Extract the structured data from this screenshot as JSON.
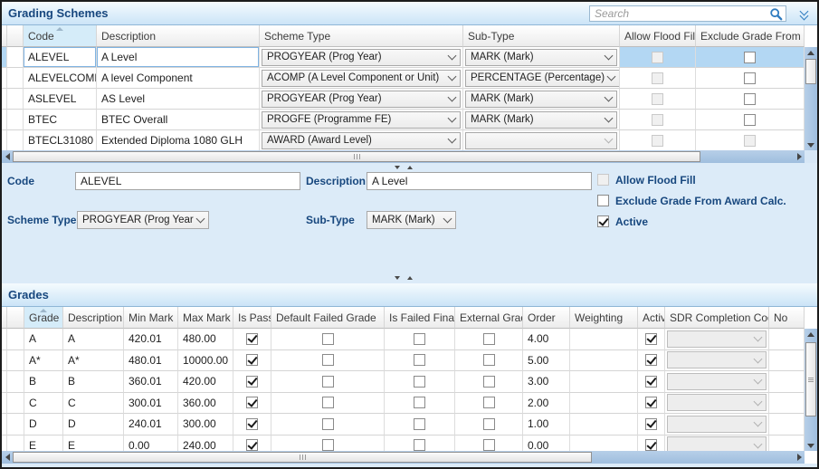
{
  "icons": {
    "search": "magnifier",
    "collapse_panel": "double-chevron-down",
    "combo": "chevron-down",
    "sort": "triangle-up",
    "check": "checkmark",
    "scroll_arrows": "triangles"
  },
  "schemes_panel": {
    "title": "Grading Schemes",
    "search_placeholder": "Search",
    "columns": [
      "Code",
      "Description",
      "Scheme Type",
      "Sub-Type",
      "Allow Flood Fill",
      "Exclude Grade From"
    ],
    "rows": [
      {
        "code": "ALEVEL",
        "description": "A Level",
        "scheme_type": "PROGYEAR (Prog Year)",
        "sub_type": "MARK (Mark)",
        "allow_flood_fill": {
          "checked": false,
          "disabled": true
        },
        "exclude_grade": {
          "checked": false,
          "disabled": false
        },
        "selected": true
      },
      {
        "code": "ALEVELCOMP",
        "description": "A level Component",
        "scheme_type": "ACOMP (A Level Component or Unit)",
        "sub_type": "PERCENTAGE (Percentage)",
        "allow_flood_fill": {
          "checked": false,
          "disabled": true
        },
        "exclude_grade": {
          "checked": false,
          "disabled": false
        }
      },
      {
        "code": "ASLEVEL",
        "description": "AS Level",
        "scheme_type": "PROGYEAR (Prog Year)",
        "sub_type": "MARK (Mark)",
        "allow_flood_fill": {
          "checked": false,
          "disabled": true
        },
        "exclude_grade": {
          "checked": false,
          "disabled": false
        }
      },
      {
        "code": "BTEC",
        "description": "BTEC Overall",
        "scheme_type": "PROGFE (Programme FE)",
        "sub_type": "MARK (Mark)",
        "allow_flood_fill": {
          "checked": false,
          "disabled": true
        },
        "exclude_grade": {
          "checked": false,
          "disabled": false
        }
      },
      {
        "code": "BTECL31080",
        "description": "Extended Diploma 1080 GLH",
        "scheme_type": "AWARD (Award Level)",
        "sub_type": "",
        "allow_flood_fill": {
          "checked": false,
          "disabled": true
        },
        "exclude_grade": {
          "checked": false,
          "disabled": true
        }
      }
    ]
  },
  "detail_form": {
    "code_label": "Code",
    "code_value": "ALEVEL",
    "description_label": "Description",
    "description_value": "A Level",
    "scheme_type_label": "Scheme Type",
    "scheme_type_value": "PROGYEAR (Prog Year)",
    "sub_type_label": "Sub-Type",
    "sub_type_value": "MARK (Mark)",
    "checkboxes": [
      {
        "label": "Allow Flood Fill",
        "checked": false,
        "disabled": true
      },
      {
        "label": "Exclude Grade From Award Calc.",
        "checked": false,
        "disabled": false
      },
      {
        "label": "Active",
        "checked": true,
        "disabled": false
      }
    ]
  },
  "grades_panel": {
    "title": "Grades",
    "columns": [
      "Grade",
      "Description",
      "Min Mark",
      "Max Mark",
      "Is Pass",
      "Default Failed Grade",
      "Is Failed Final",
      "External Grade",
      "Order",
      "Weighting",
      "Active",
      "SDR Completion Code",
      "No"
    ],
    "rows": [
      {
        "grade": "A",
        "description": "A",
        "min_mark": "420.01",
        "max_mark": "480.00",
        "is_pass": true,
        "default_failed_grade": false,
        "is_failed_final": false,
        "external_grade": false,
        "order": "4.00",
        "weighting": "",
        "active": true,
        "sdr_completion_code": "",
        "no": ""
      },
      {
        "grade": "A*",
        "description": "A*",
        "min_mark": "480.01",
        "max_mark": "10000.00",
        "is_pass": true,
        "default_failed_grade": false,
        "is_failed_final": false,
        "external_grade": false,
        "order": "5.00",
        "weighting": "",
        "active": true,
        "sdr_completion_code": "",
        "no": ""
      },
      {
        "grade": "B",
        "description": "B",
        "min_mark": "360.01",
        "max_mark": "420.00",
        "is_pass": true,
        "default_failed_grade": false,
        "is_failed_final": false,
        "external_grade": false,
        "order": "3.00",
        "weighting": "",
        "active": true,
        "sdr_completion_code": "",
        "no": ""
      },
      {
        "grade": "C",
        "description": "C",
        "min_mark": "300.01",
        "max_mark": "360.00",
        "is_pass": true,
        "default_failed_grade": false,
        "is_failed_final": false,
        "external_grade": false,
        "order": "2.00",
        "weighting": "",
        "active": true,
        "sdr_completion_code": "",
        "no": ""
      },
      {
        "grade": "D",
        "description": "D",
        "min_mark": "240.01",
        "max_mark": "300.00",
        "is_pass": true,
        "default_failed_grade": false,
        "is_failed_final": false,
        "external_grade": false,
        "order": "1.00",
        "weighting": "",
        "active": true,
        "sdr_completion_code": "",
        "no": ""
      },
      {
        "grade": "E",
        "description": "E",
        "min_mark": "0.00",
        "max_mark": "240.00",
        "is_pass": true,
        "default_failed_grade": false,
        "is_failed_final": false,
        "external_grade": false,
        "order": "0.00",
        "weighting": "",
        "active": true,
        "sdr_completion_code": "",
        "no": ""
      }
    ]
  }
}
